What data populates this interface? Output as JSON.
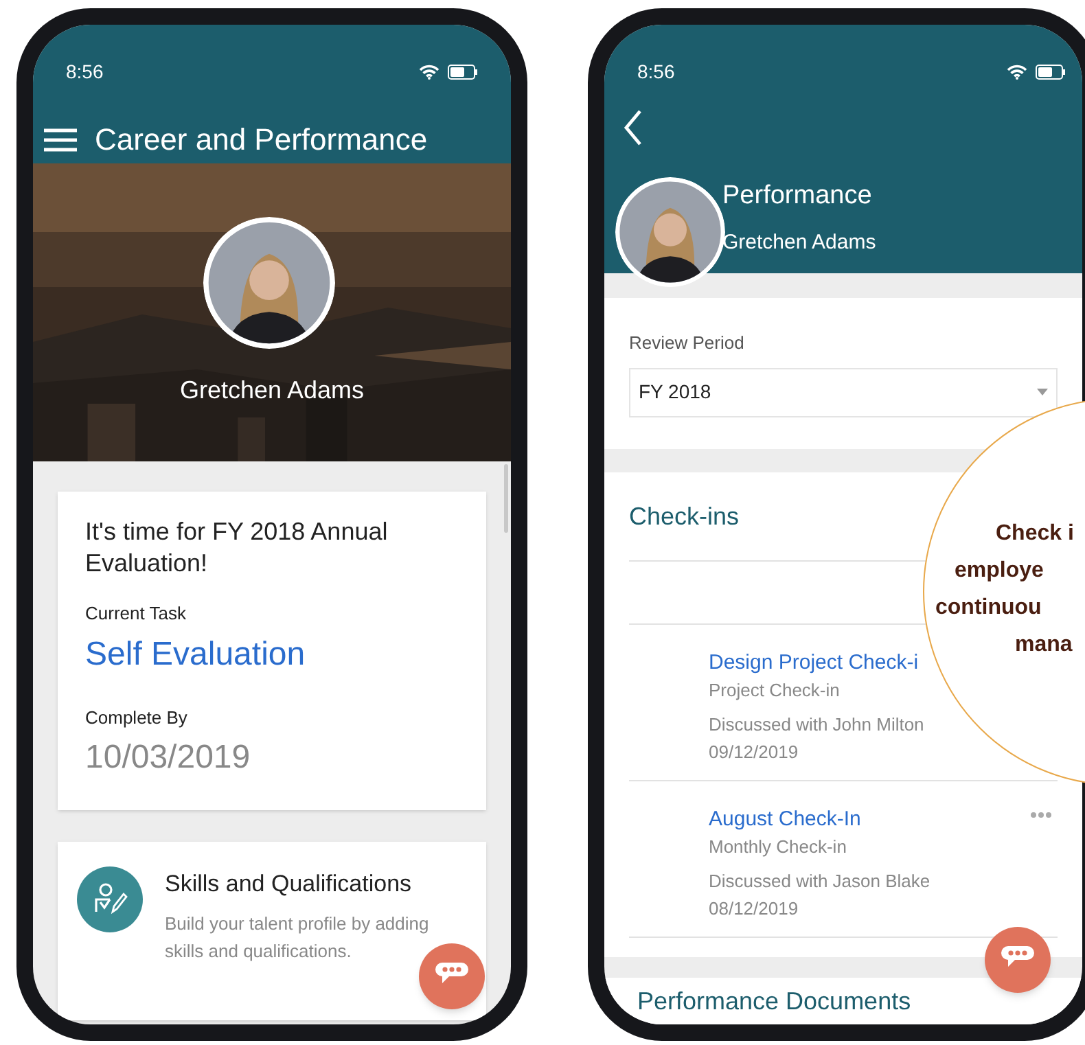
{
  "home_screen": {
    "status_bar": {
      "time": "8:56"
    },
    "header": {
      "title": "Career and Performance"
    },
    "profile": {
      "name": "Gretchen Adams"
    },
    "evaluation_card": {
      "title": "It's time for FY 2018 Annual Evaluation!",
      "current_task_label": "Current Task",
      "current_task": "Self Evaluation",
      "complete_by_label": "Complete By",
      "complete_by": "10/03/2019"
    },
    "skills_card": {
      "title": "Skills and Qualifications",
      "description": "Build your talent profile by adding skills and qualifications."
    }
  },
  "performance_screen": {
    "status_bar": {
      "time": "8:56"
    },
    "header": {
      "title": "Performance",
      "subtitle": "Gretchen Adams"
    },
    "review_period": {
      "label": "Review Period",
      "value": "FY 2018"
    },
    "checkins": {
      "title": "Check-ins",
      "items": [
        {
          "title": "Design Project Check-i",
          "type": "Project Check-in",
          "discussed": "Discussed with John Milton",
          "date": "09/12/2019"
        },
        {
          "title": "August Check-In",
          "type": "Monthly Check-in",
          "discussed": "Discussed with Jason Blake",
          "date": "08/12/2019",
          "more_menu": true
        }
      ]
    },
    "next_section": {
      "title": "Performance Documents"
    }
  },
  "callout": {
    "lines": [
      "Check i",
      "employe",
      "continuou",
      "mana"
    ]
  }
}
